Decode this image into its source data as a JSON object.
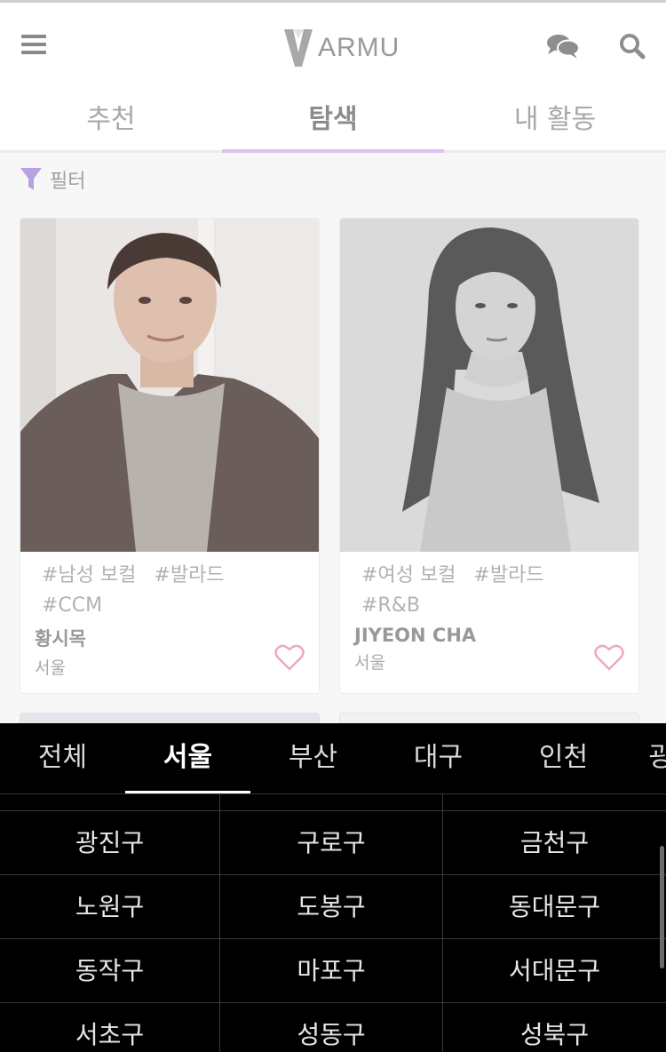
{
  "header": {
    "logo_text": "ARMU",
    "menu_icon": "hamburger-menu-icon",
    "chat_icon": "chat-bubbles-icon",
    "search_icon": "search-icon"
  },
  "tabs": [
    {
      "label": "추천",
      "active": false
    },
    {
      "label": "탐색",
      "active": true
    },
    {
      "label": "내 활동",
      "active": false
    }
  ],
  "filter": {
    "label": "필터",
    "icon": "funnel-icon",
    "icon_color": "#b7a2e0"
  },
  "cards": [
    {
      "tags_line1": [
        "#남성 보컬",
        "#발라드"
      ],
      "tags_line2": [
        "#CCM"
      ],
      "name": "황시목",
      "location": "서울",
      "favorite": false
    },
    {
      "tags_line1": [
        "#여성 보컬",
        "#발라드"
      ],
      "tags_line2": [
        "#R&B"
      ],
      "name": "JIYEON CHA",
      "location": "서울",
      "favorite": false
    }
  ],
  "region_sheet": {
    "tabs": [
      {
        "label": "전체",
        "active": false
      },
      {
        "label": "서울",
        "active": true
      },
      {
        "label": "부산",
        "active": false
      },
      {
        "label": "대구",
        "active": false
      },
      {
        "label": "인천",
        "active": false
      }
    ],
    "more_peek": "광",
    "districts": [
      [
        "광진구",
        "구로구",
        "금천구"
      ],
      [
        "노원구",
        "도봉구",
        "동대문구"
      ],
      [
        "동작구",
        "마포구",
        "서대문구"
      ],
      [
        "서초구",
        "성동구",
        "성북구"
      ]
    ]
  },
  "colors": {
    "accent": "#d8c3ef",
    "heart": "#f1a9b8",
    "sheet_bg": "#000000"
  }
}
